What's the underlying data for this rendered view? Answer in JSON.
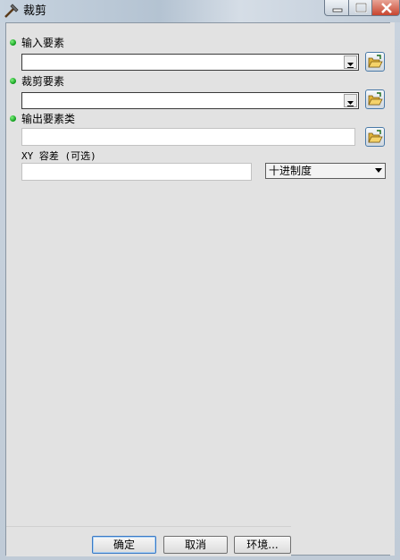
{
  "window": {
    "title": "裁剪",
    "icon": "scissors-tool-icon"
  },
  "params": {
    "input_features": {
      "label": "输入要素",
      "value": "",
      "required": true
    },
    "clip_features": {
      "label": "裁剪要素",
      "value": "",
      "required": true
    },
    "output_feature_class": {
      "label": "输出要素类",
      "value": "",
      "required": true
    },
    "xy_tolerance": {
      "label": "XY 容差 (可选)",
      "value": "",
      "unit": "十进制度"
    }
  },
  "buttons": {
    "ok": "确定",
    "cancel": "取消",
    "environments": "环境..."
  },
  "colors": {
    "required_dot": "#1aa52a",
    "browse_border": "#4a7aa8",
    "default_button_border": "#3a79c4"
  }
}
